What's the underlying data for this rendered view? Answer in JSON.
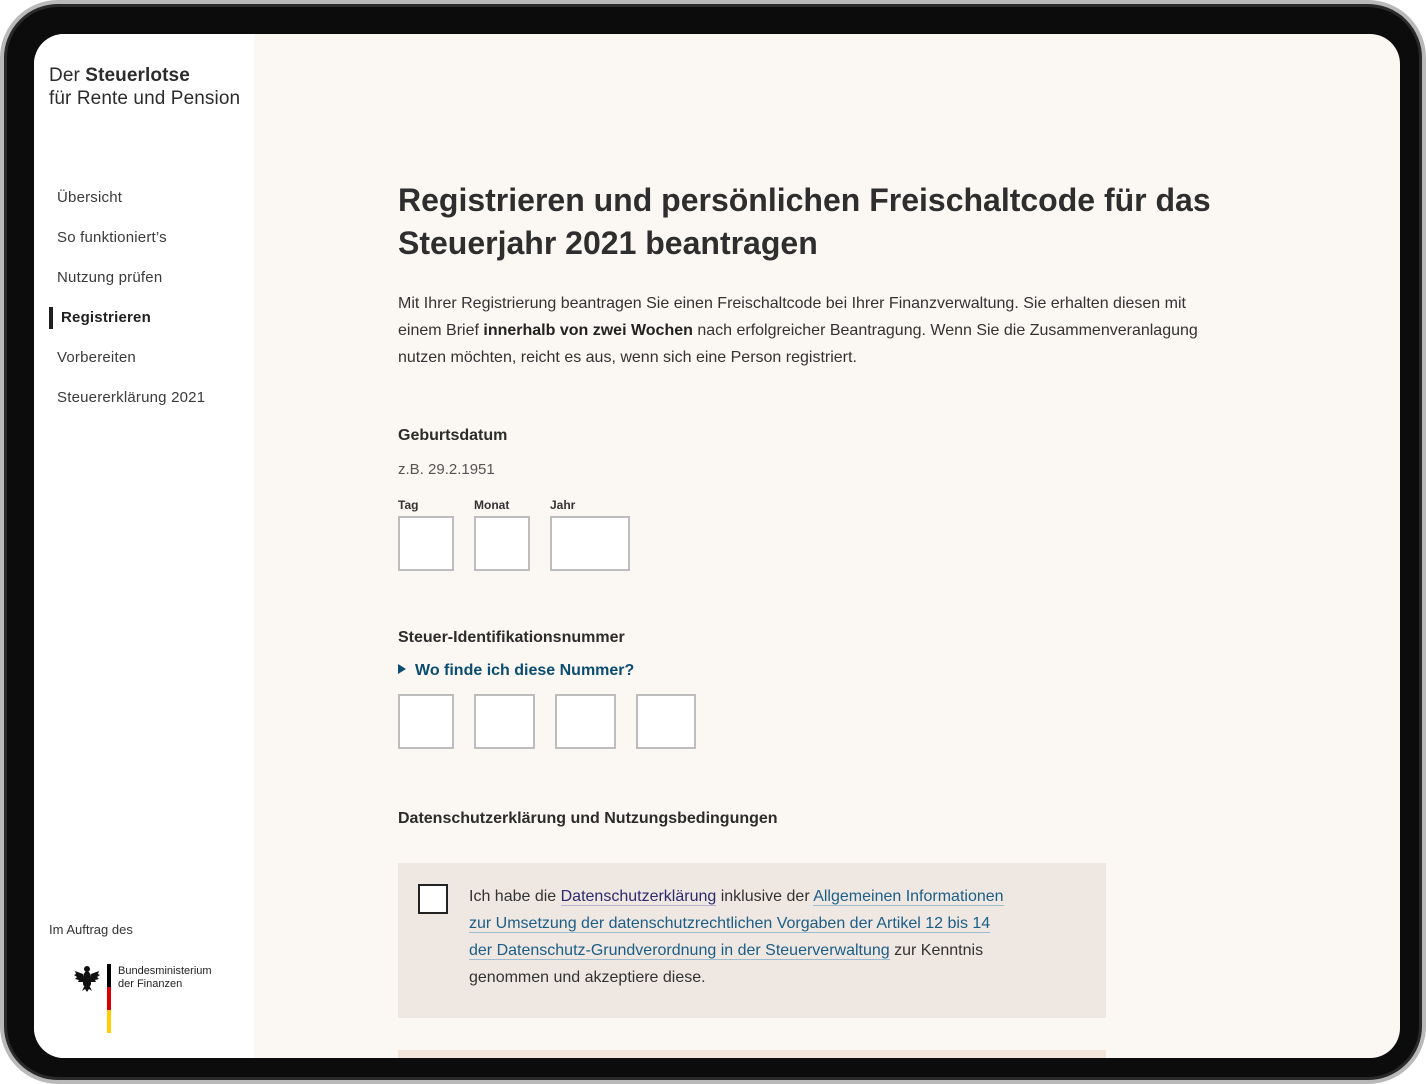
{
  "brand": {
    "prefix": "Der ",
    "name": "Steuerlotse",
    "subtitle": "für Rente und Pension"
  },
  "nav": {
    "items": [
      {
        "label": "Übersicht"
      },
      {
        "label": "So funktioniert’s"
      },
      {
        "label": "Nutzung prüfen"
      },
      {
        "label": "Registrieren",
        "active": true
      },
      {
        "label": "Vorbereiten"
      },
      {
        "label": "Steuererklärung 2021"
      }
    ]
  },
  "footer": {
    "auftrag": "Im Auftrag des",
    "ministry_line1": "Bundesministerium",
    "ministry_line2": "der Finanzen",
    "flag_colors": [
      "#000000",
      "#dd0000",
      "#ffce00"
    ]
  },
  "main": {
    "title": "Registrieren und persönlichen Freischaltcode für das Steuerjahr 2021 beantragen",
    "intro_part1": "Mit Ihrer Registrierung beantragen Sie einen Freischaltcode bei Ihrer Finanzverwaltung. Sie erhalten diesen mit einem Brief ",
    "intro_bold": "innerhalb von zwei Wochen",
    "intro_part2": " nach erfolgreicher Beantragung. Wenn Sie die Zusammenveranlagung nutzen möchten, reicht es aus, wenn sich eine Person registriert.",
    "birthdate": {
      "label": "Geburtsdatum",
      "hint": "z.B. 29.2.1951",
      "day_label": "Tag",
      "day_value": "",
      "month_label": "Monat",
      "month_value": "",
      "year_label": "Jahr",
      "year_value": ""
    },
    "taxid": {
      "label": "Steuer-Identifikationsnummer",
      "help_link": "Wo finde ich diese Nummer?",
      "parts": [
        "",
        "",
        "",
        ""
      ]
    },
    "consent": {
      "heading": "Datenschutzerklärung und Nutzungsbedingungen",
      "text1": "Ich habe die ",
      "link1": "Datenschutzerklärung",
      "text2": " inklusive der ",
      "link2": "Allgemeinen Informationen zur Umsetzung der datenschutzrechtlichen Vorgaben der Artikel 12 bis 14 der Datenschutz-Grundverordnung in der Steuerverwaltung",
      "text3": " zur Kenntnis genommen und akzeptiere diese.",
      "checked": false
    }
  },
  "colors": {
    "background": "#fbf7f3",
    "link": "#0a4d72",
    "consent_bg": "#efe7e2"
  }
}
